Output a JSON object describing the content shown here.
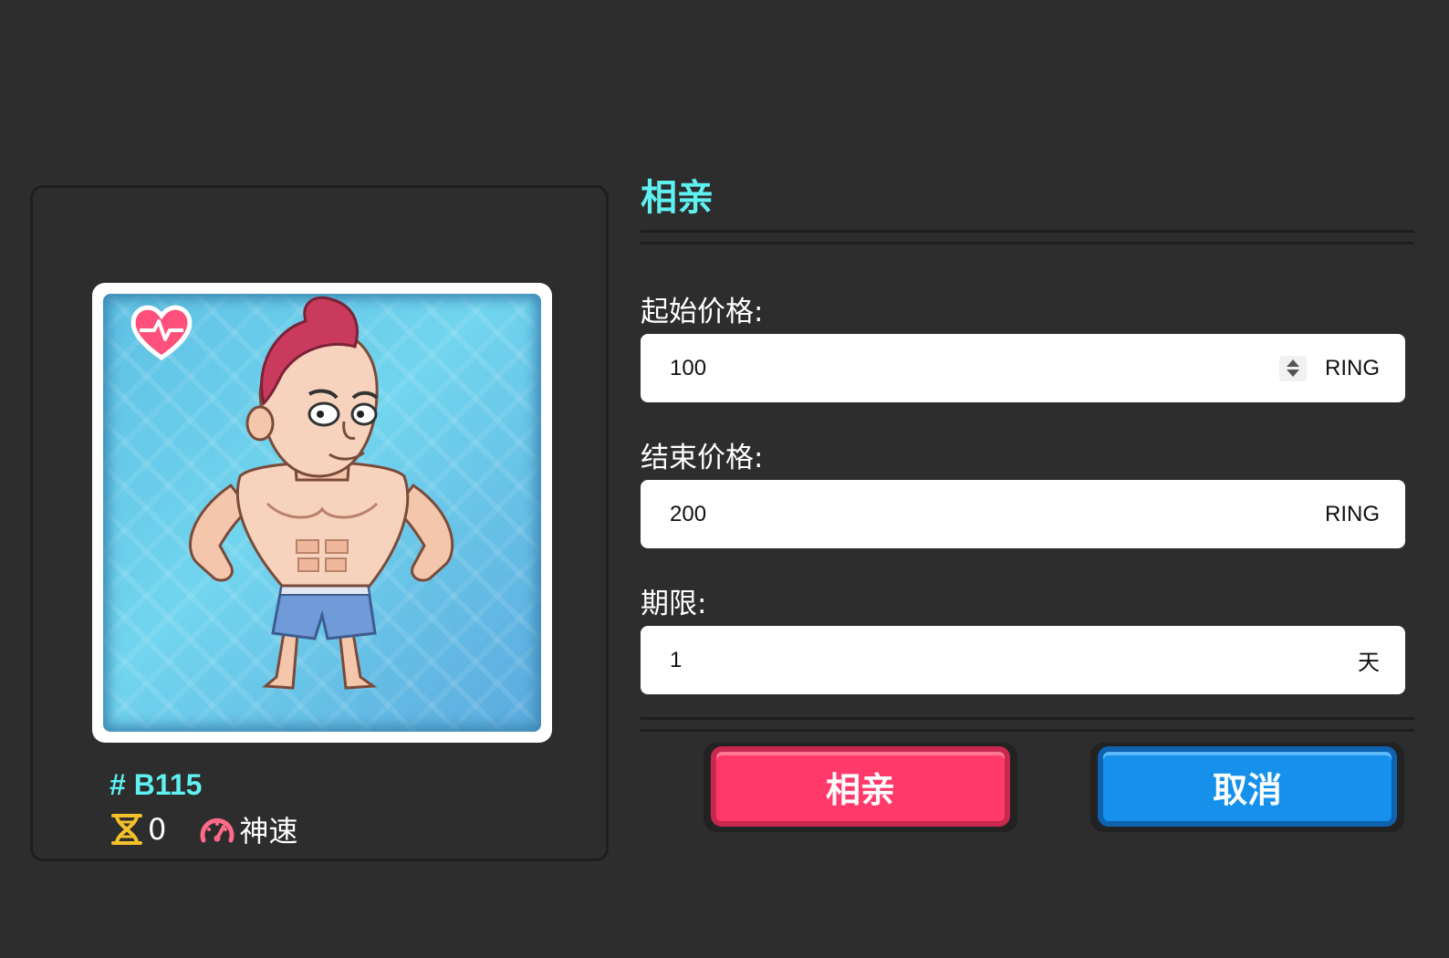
{
  "card": {
    "nft_id": "# B115",
    "generation": "0",
    "speed": "神速",
    "icons": {
      "badge": "heart-pulse-icon",
      "generation": "dna-icon",
      "speed": "speedometer-icon"
    },
    "colors": {
      "id": "#5ff0f0",
      "dna": "#f5c12a",
      "speed": "#ff6a8a"
    }
  },
  "form": {
    "title": "相亲",
    "start_price": {
      "label": "起始价格:",
      "value": "100",
      "unit": "RING"
    },
    "end_price": {
      "label": "结束价格:",
      "value": "200",
      "unit": "RING"
    },
    "duration": {
      "label": "期限:",
      "value": "1",
      "unit": "天"
    }
  },
  "buttons": {
    "confirm": {
      "label": "相亲",
      "color": "#ff3a6a"
    },
    "cancel": {
      "label": "取消",
      "color": "#1591ec"
    }
  }
}
